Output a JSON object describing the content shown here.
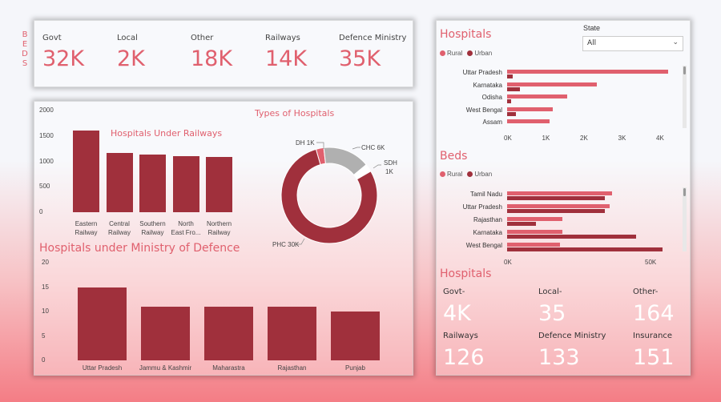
{
  "kpis": {
    "side_label_letters": [
      "B",
      "E",
      "D",
      "S"
    ],
    "items": [
      {
        "label": "Govt",
        "value": "32K"
      },
      {
        "label": "Local",
        "value": "2K"
      },
      {
        "label": "Other",
        "value": "18K"
      },
      {
        "label": "Railways",
        "value": "14K"
      },
      {
        "label": "Defence Ministry",
        "value": "35K"
      }
    ]
  },
  "railways_chart": {
    "title": "Hospitals Under Railways",
    "yticks": [
      "2000",
      "1500",
      "1000",
      "500",
      "0"
    ],
    "chart_data": {
      "type": "bar",
      "categories": [
        "Eastern Railway",
        "Central Railway",
        "Southern Railway",
        "North East Fro...",
        "Northern Railway"
      ],
      "values": [
        1600,
        1160,
        1130,
        1100,
        1090
      ],
      "ylim": [
        0,
        2000
      ]
    },
    "category_lines": [
      [
        "Eastern",
        "Railway"
      ],
      [
        "Central",
        "Railway"
      ],
      [
        "Southern",
        "Railway"
      ],
      [
        "North",
        "East Fro..."
      ],
      [
        "Northern",
        "Railway"
      ]
    ]
  },
  "types_chart": {
    "title": "Types of Hospitals",
    "chart_data": {
      "type": "pie",
      "labels": [
        "PHC",
        "DH",
        "CHC",
        "SDH"
      ],
      "values": [
        30,
        1,
        6,
        1
      ],
      "colors": [
        "#a0303c",
        "#e0606e",
        "#b0b0b0",
        "#ffffff"
      ]
    },
    "slice_labels": {
      "phc": "PHC 30K",
      "dh": "DH 1K",
      "chc": "CHC 6K",
      "sdh1": "SDH",
      "sdh2": "1K"
    }
  },
  "defence_chart": {
    "title": "Hospitals under Ministry of Defence",
    "yticks": [
      "20",
      "15",
      "10",
      "5",
      "0"
    ],
    "chart_data": {
      "type": "bar",
      "categories": [
        "Uttar Pradesh",
        "Jammu & Kashmir",
        "Maharastra",
        "Rajasthan",
        "Punjab"
      ],
      "values": [
        15,
        11,
        11,
        11,
        10
      ],
      "ylim": [
        0,
        20
      ]
    }
  },
  "hospitals_chart": {
    "title": "Hospitals",
    "legend": {
      "rural": "Rural",
      "urban": "Urban"
    },
    "xticks": [
      "0K",
      "1K",
      "2K",
      "3K",
      "4K"
    ],
    "chart_data": {
      "type": "bar",
      "orientation": "horizontal",
      "categories": [
        "Uttar Pradesh",
        "Karnataka",
        "Odisha",
        "West Bengal",
        "Assam"
      ],
      "series": [
        {
          "name": "Rural",
          "values": [
            4400,
            2450,
            1650,
            1250,
            1150
          ]
        },
        {
          "name": "Urban",
          "values": [
            150,
            350,
            100,
            250,
            0
          ]
        }
      ],
      "xlim": [
        0,
        4600
      ]
    }
  },
  "state_filter": {
    "label": "State",
    "selected": "All"
  },
  "beds_chart": {
    "title": "Beds",
    "legend": {
      "rural": "Rural",
      "urban": "Urban"
    },
    "xticks": [
      "0K",
      "50K"
    ],
    "chart_data": {
      "type": "bar",
      "orientation": "horizontal",
      "categories": [
        "Tamil Nadu",
        "Uttar Pradesh",
        "Rajasthan",
        "Karnataka",
        "West Bengal"
      ],
      "series": [
        {
          "name": "Rural",
          "values": [
            40000,
            39000,
            21000,
            21000,
            20000
          ]
        },
        {
          "name": "Urban",
          "values": [
            37000,
            37000,
            11000,
            49000,
            59000
          ]
        }
      ],
      "xlim": [
        0,
        63000
      ]
    }
  },
  "hospital_stats": {
    "title": "Hospitals",
    "items": [
      {
        "label": "Govt-",
        "value": "4K"
      },
      {
        "label": "Local-",
        "value": "35"
      },
      {
        "label": "Other-",
        "value": "164"
      },
      {
        "label": "Railways",
        "value": "126"
      },
      {
        "label": "Defence Ministry",
        "value": "133"
      },
      {
        "label": "Insurance",
        "value": "151"
      }
    ]
  }
}
